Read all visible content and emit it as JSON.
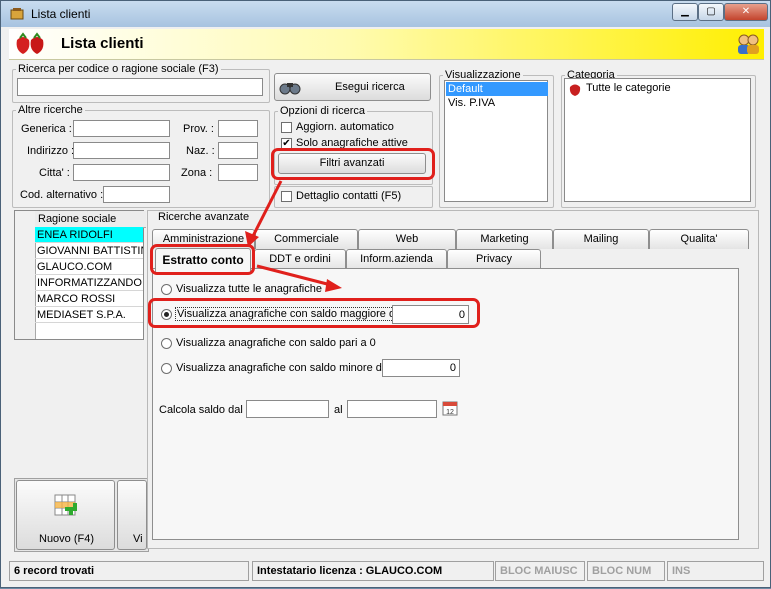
{
  "window": {
    "title": "Lista clienti"
  },
  "header": {
    "title": "Lista clienti"
  },
  "search": {
    "legend": "Ricerca per codice o ragione sociale (F3)",
    "value": "",
    "execute_label": "Esegui ricerca"
  },
  "other_searches": {
    "legend": "Altre ricerche",
    "generica": "Generica :",
    "indirizzo": "Indirizzo :",
    "citta": "Citta' :",
    "cod_alt": "Cod. alternativo :",
    "prov": "Prov. :",
    "naz": "Naz. :",
    "zona": "Zona :"
  },
  "search_options": {
    "legend": "Opzioni di ricerca",
    "auto_update": "Aggiorn. automatico",
    "active_only": "Solo anagrafiche attive",
    "advanced_filters": "Filtri avanzati",
    "contact_detail": "Dettaglio contatti (F5)"
  },
  "view": {
    "legend": "Visualizzazione",
    "items": [
      "Default",
      "Vis. P.IVA"
    ]
  },
  "category": {
    "legend": "Categoria",
    "items": [
      "Tutte le categorie"
    ]
  },
  "grid": {
    "header": "Ragione sociale",
    "rows": [
      "ENEA RIDOLFI",
      "GIOVANNI BATTISTINI",
      "GLAUCO.COM",
      "INFORMATIZZANDO S",
      "MARCO ROSSI",
      "MEDIASET S.P.A."
    ]
  },
  "advanced": {
    "legend": "Ricerche avanzate",
    "tabs_top": [
      "Amministrazione",
      "Commerciale",
      "Web",
      "Marketing",
      "Mailing",
      "Qualita'"
    ],
    "tabs_bottom": [
      "Estratto conto",
      "DDT e ordini",
      "Inform.azienda",
      "Privacy"
    ],
    "opt_all": "Visualizza tutte le anagrafiche",
    "opt_greater": "Visualizza anagrafiche con saldo maggiore di",
    "greater_value": "0",
    "opt_zero": "Visualizza anagrafiche con saldo pari a 0",
    "opt_less": "Visualizza anagrafiche con saldo minore di",
    "less_value": "0",
    "calc_from": "Calcola saldo dal",
    "calc_to": "al"
  },
  "actions": {
    "new_label": "Nuovo (F4)",
    "second_label": "Vi"
  },
  "status": {
    "records": "6 record trovati",
    "license": "Intestatario licenza : GLAUCO.COM",
    "caps": "BLOC MAIUSC",
    "num": "BLOC NUM",
    "ins": "INS"
  },
  "colors": {
    "selection": "#00ffff",
    "highlight_red": "#e0201c",
    "header_yellow": "#ffef00"
  }
}
